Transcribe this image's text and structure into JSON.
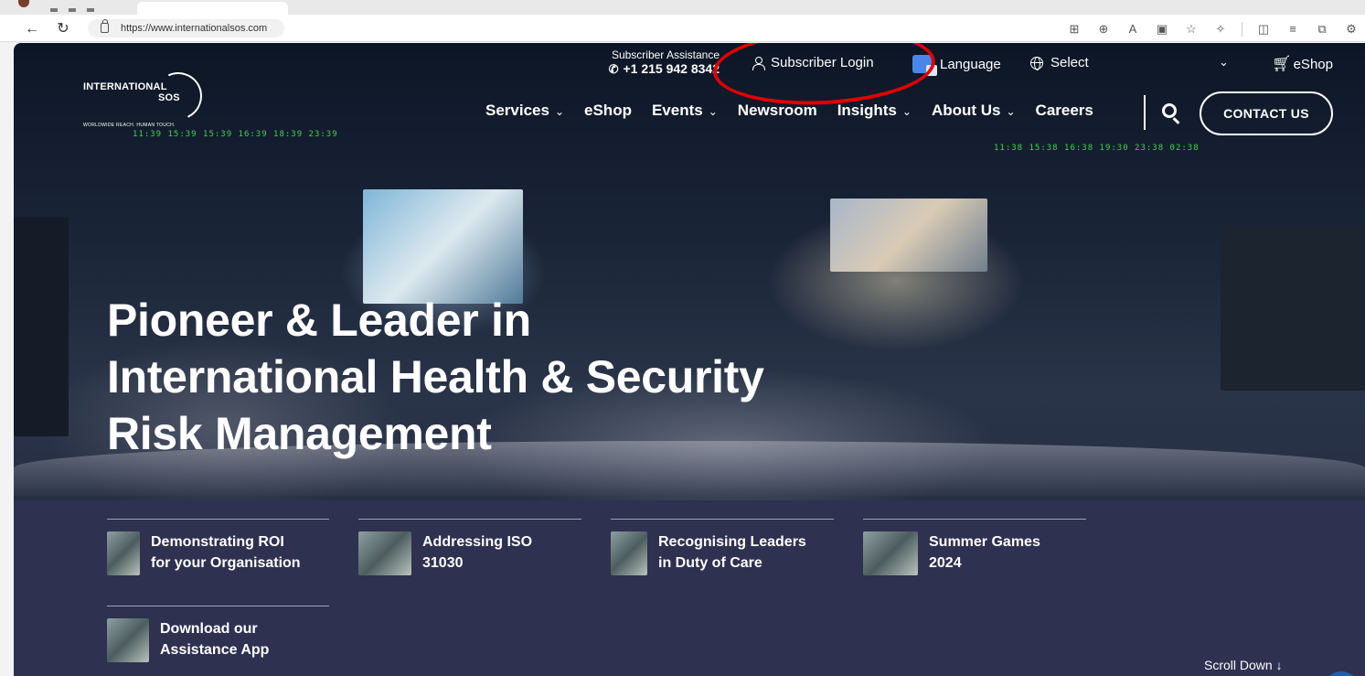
{
  "browser": {
    "url": "https://www.internationalsos.com",
    "back_icon": "back-arrow-icon",
    "refresh_icon": "refresh-icon"
  },
  "site": {
    "logo": {
      "line1": "INTERNATIONAL",
      "line2": "SOS",
      "tagline": "WORLDWIDE REACH. HUMAN TOUCH."
    },
    "utility": {
      "assistance_label": "Subscriber Assistance",
      "assistance_phone": "+1 215 942 8342",
      "login": "Subscriber Login",
      "language": "Language",
      "select": "Select",
      "eshop": "eShop"
    },
    "nav": [
      {
        "label": "Services",
        "chevron": true
      },
      {
        "label": "eShop",
        "chevron": false
      },
      {
        "label": "Events",
        "chevron": true
      },
      {
        "label": "Newsroom",
        "chevron": false
      },
      {
        "label": "Insights",
        "chevron": true
      },
      {
        "label": "About Us",
        "chevron": true
      },
      {
        "label": "Careers",
        "chevron": false
      }
    ],
    "contact_button": "CONTACT US",
    "hero": {
      "line1": "Pioneer & Leader in",
      "line2": "International Health & Security",
      "line3": "Risk Management"
    },
    "features": [
      {
        "line1": "Demonstrating ROI",
        "line2": "for your Organisation"
      },
      {
        "line1": "Addressing ISO",
        "line2": "31030"
      },
      {
        "line1": "Recognising Leaders",
        "line2": "in Duty of Care"
      },
      {
        "line1": "Summer Games",
        "line2": "2024"
      },
      {
        "line1": "Download our",
        "line2": "Assistance App"
      }
    ],
    "scroll_down": "Scroll Down ↓",
    "tickers": {
      "left": "11:39  15:39  15:39  16:39  18:39  23:39",
      "right": "11:38  15:38  16:38  19:30  23:38  02:38"
    }
  },
  "colors": {
    "highlight_ring": "#e00000",
    "accent": "#4a86e8"
  }
}
